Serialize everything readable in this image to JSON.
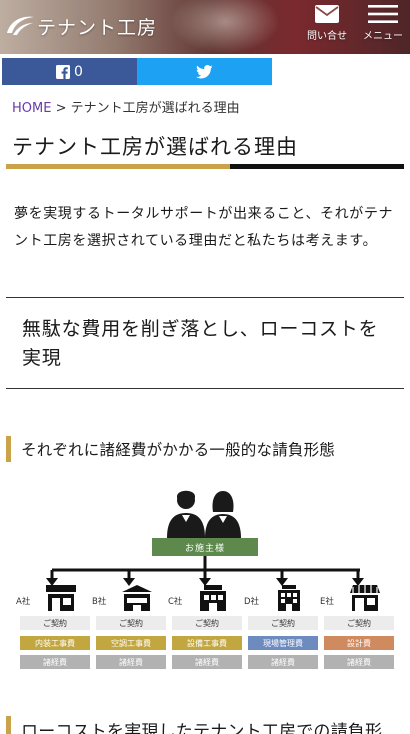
{
  "header": {
    "logo_text": "テナント工房",
    "contact_label": "問い合せ",
    "menu_label": "メニュー"
  },
  "share": {
    "facebook_count": "0"
  },
  "breadcrumb": {
    "home": "HOME",
    "separator": ">",
    "current": "テナント工房が選ばれる理由"
  },
  "page_title": "テナント工房が選ばれる理由",
  "intro": "夢を実現するトータルサポートが出来ること、それがテナント工房を選択されている理由だと私たちは考えます。",
  "lead": "無駄な費用を削ぎ落とし、ローコストを実現",
  "section1_heading": "それぞれに諸経費がかかる一般的な請負形態",
  "diagram": {
    "client_label": "お施主様",
    "companies": [
      {
        "name": "A社",
        "contract": "ご契約",
        "cost": "内装工事費",
        "misc": "諸経費",
        "cost_color": "#c2a63f"
      },
      {
        "name": "B社",
        "contract": "ご契約",
        "cost": "空調工事費",
        "misc": "諸経費",
        "cost_color": "#c2a63f"
      },
      {
        "name": "C社",
        "contract": "ご契約",
        "cost": "設備工事費",
        "misc": "諸経費",
        "cost_color": "#c2a63f"
      },
      {
        "name": "D社",
        "contract": "ご契約",
        "cost": "現場管理費",
        "misc": "諸経費",
        "cost_color": "#6e8bbf"
      },
      {
        "name": "E社",
        "contract": "ご契約",
        "cost": "設計費",
        "misc": "諸経費",
        "cost_color": "#cf8a5f"
      }
    ]
  },
  "section2_heading": "ローコストを実現したテナント工房での請負形",
  "colors": {
    "accent_gold": "#c9a24a",
    "facebook": "#3b5998",
    "twitter": "#1da1f2",
    "client_green": "#5d8a4c",
    "breadcrumb_link": "#6a3aa8"
  }
}
